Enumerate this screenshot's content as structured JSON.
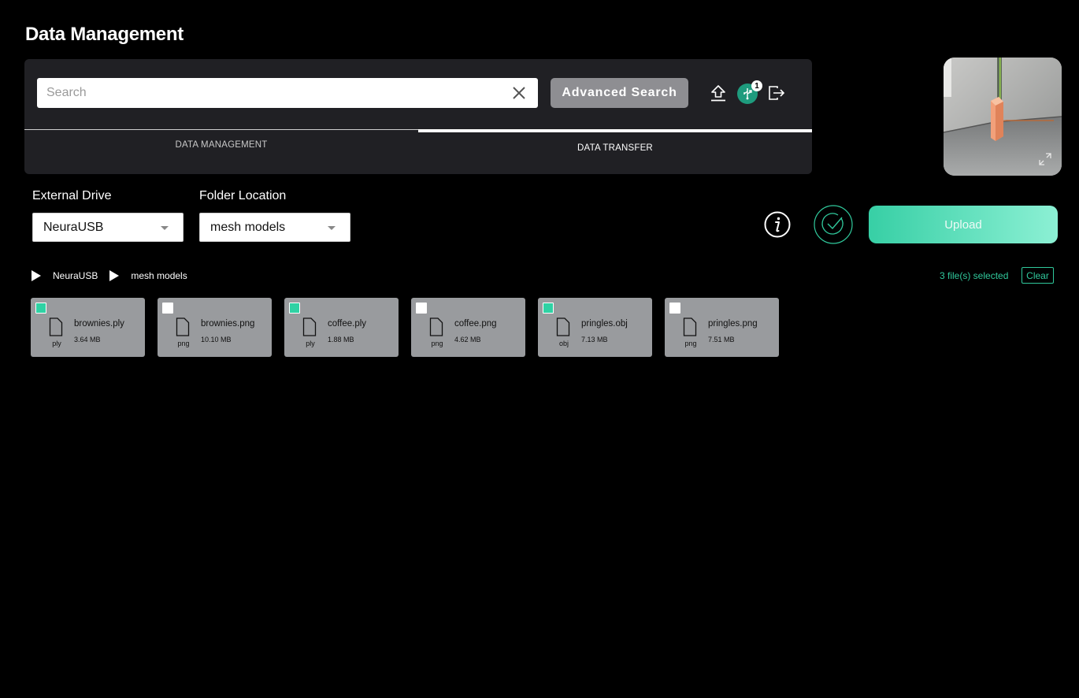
{
  "page": {
    "title": "Data Management"
  },
  "search": {
    "placeholder": "Search",
    "value": "",
    "advanced_label": "Advanced Search"
  },
  "toolbar": {
    "notification_count": "1"
  },
  "tabs": [
    {
      "label": "DATA MANAGEMENT",
      "active": false
    },
    {
      "label": "DATA TRANSFER",
      "active": true
    }
  ],
  "external_drive": {
    "label": "External Drive",
    "value": "NeuraUSB"
  },
  "folder_location": {
    "label": "Folder Location",
    "value": "mesh models"
  },
  "upload": {
    "label": "Upload"
  },
  "breadcrumb": [
    "NeuraUSB",
    "mesh models"
  ],
  "selection": {
    "count_text": "3 file(s) selected",
    "clear_label": "Clear"
  },
  "files": [
    {
      "name": "brownies.ply",
      "size": "3.64 MB",
      "ext": "ply",
      "checked": true
    },
    {
      "name": "brownies.png",
      "size": "10.10 MB",
      "ext": "png",
      "checked": false
    },
    {
      "name": "coffee.ply",
      "size": "1.88 MB",
      "ext": "ply",
      "checked": true
    },
    {
      "name": "coffee.png",
      "size": "4.62 MB",
      "ext": "png",
      "checked": false
    },
    {
      "name": "pringles.obj",
      "size": "7.13 MB",
      "ext": "obj",
      "checked": true
    },
    {
      "name": "pringles.png",
      "size": "7.51 MB",
      "ext": "png",
      "checked": false
    }
  ],
  "colors": {
    "accent": "#30c99c",
    "badge": "#1e9b7d",
    "panel": "#202024",
    "card": "#999b9e"
  }
}
